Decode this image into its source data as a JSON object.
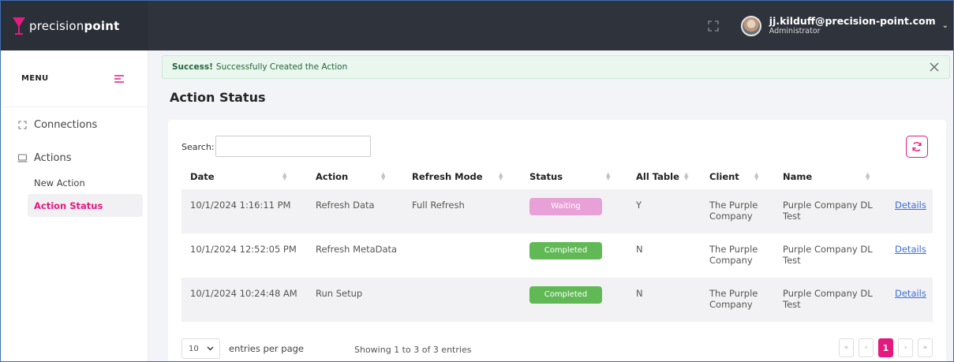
{
  "colors": {
    "accent": "#e5197f",
    "topbar": "#2f333c",
    "waiting": "#e8a1d7",
    "completed": "#60b955",
    "link": "#3a6fd8"
  },
  "brand": {
    "text_light": "precision",
    "text_bold": "point"
  },
  "user": {
    "email": "jj.kilduff@precision-point.com",
    "role": "Administrator"
  },
  "sidebar": {
    "menu_label": "MENU",
    "items": [
      {
        "label": "Connections",
        "icon": "connections-icon"
      },
      {
        "label": "Actions",
        "icon": "actions-icon"
      }
    ],
    "sub_items": [
      {
        "label": "New Action",
        "active": false
      },
      {
        "label": "Action Status",
        "active": true
      }
    ]
  },
  "alert": {
    "strong": "Success!",
    "message": "Successfully Created the Action"
  },
  "page": {
    "title": "Action Status"
  },
  "search": {
    "label": "Search:",
    "value": "",
    "placeholder": ""
  },
  "table": {
    "columns": [
      "Date",
      "Action",
      "Refresh Mode",
      "Status",
      "All Table",
      "Client",
      "Name"
    ],
    "rows": [
      {
        "date": "10/1/2024 1:16:11 PM",
        "action": "Refresh Data",
        "mode": "Full Refresh",
        "status": "Waiting",
        "all_table": "Y",
        "client": "The Purple Company",
        "name": "Purple Company DL Test",
        "details": "Details"
      },
      {
        "date": "10/1/2024 12:52:05 PM",
        "action": "Refresh MetaData",
        "mode": "",
        "status": "Completed",
        "all_table": "N",
        "client": "The Purple Company",
        "name": "Purple Company DL Test",
        "details": "Details"
      },
      {
        "date": "10/1/2024 10:24:48 AM",
        "action": "Run Setup",
        "mode": "",
        "status": "Completed",
        "all_table": "N",
        "client": "The Purple Company",
        "name": "Purple Company DL Test",
        "details": "Details"
      }
    ]
  },
  "footer": {
    "page_size": "10",
    "entries_label": "entries per page",
    "showing": "Showing 1 to 3 of 3 entries",
    "pager": {
      "first": "«",
      "prev": "‹",
      "current": "1",
      "next": "›",
      "last": "»"
    }
  }
}
